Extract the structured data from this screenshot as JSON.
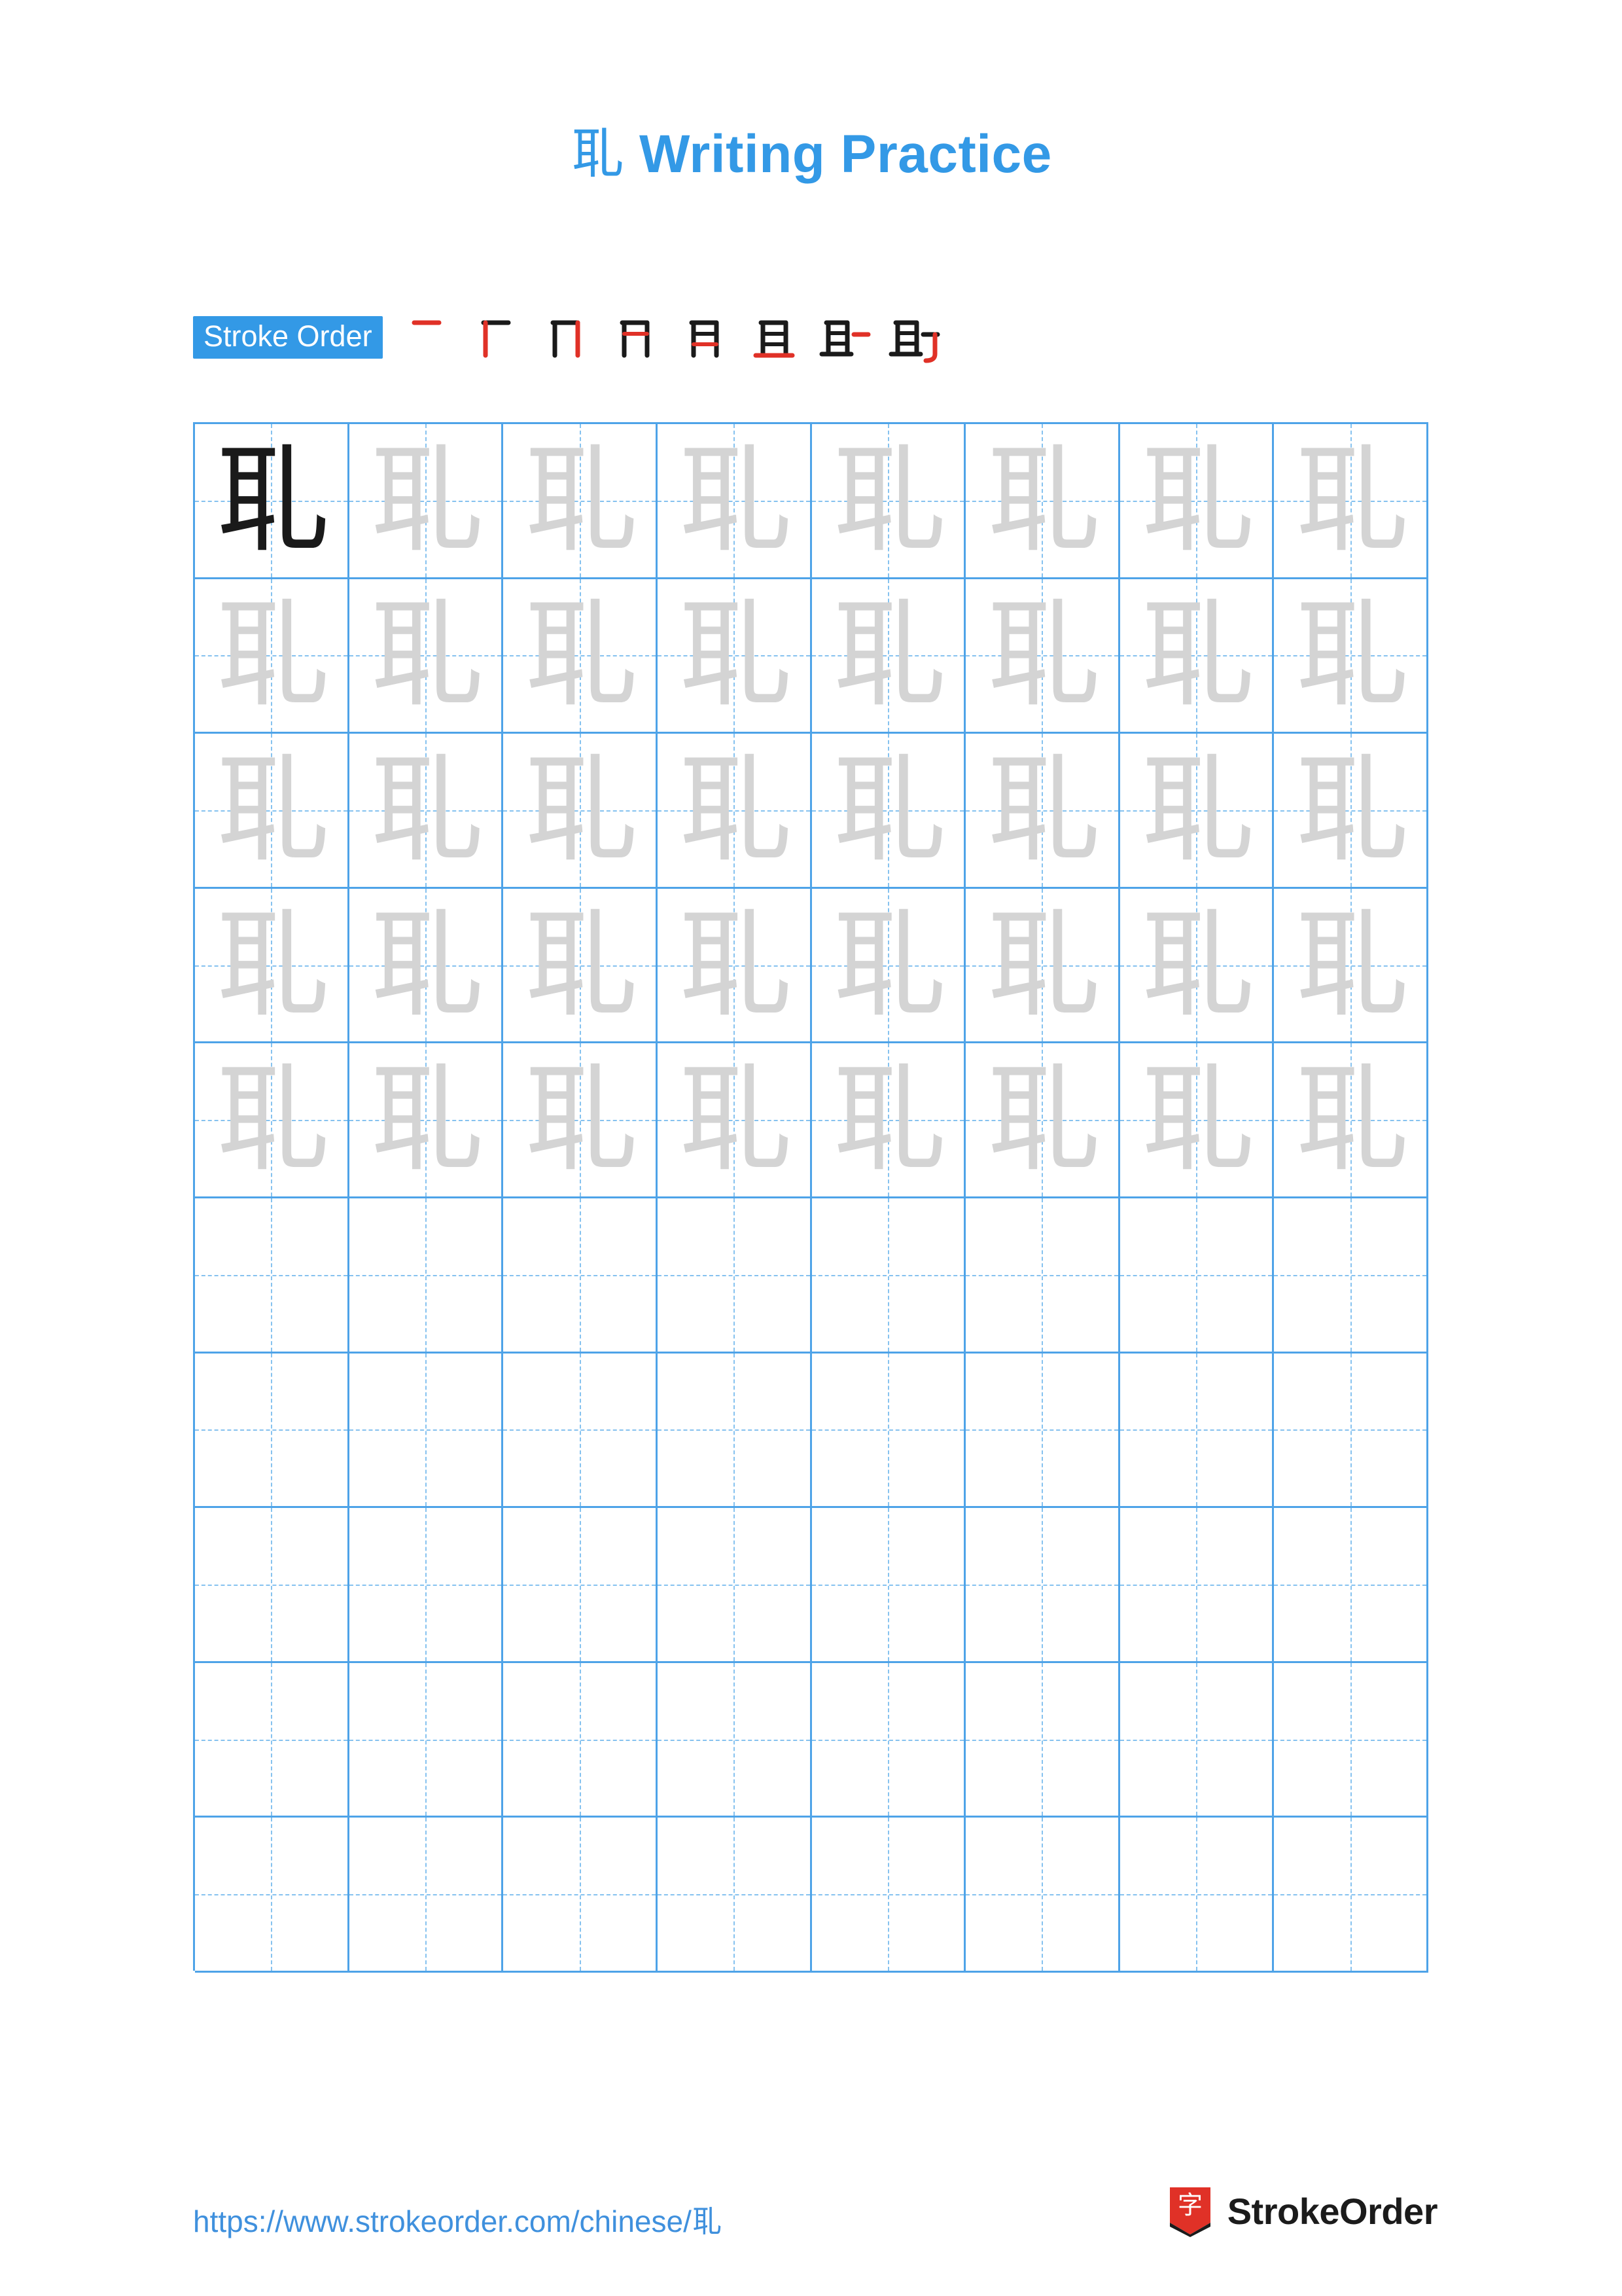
{
  "page": {
    "title_character": "耴",
    "title_suffix": " Writing Practice",
    "accent_color": "#3399e6",
    "grid_line_color": "#4ea3e8",
    "guide_line_color": "#86c2ef",
    "trace_glyph_color": "#d4d4d4",
    "model_glyph_color": "#1a1a1a"
  },
  "stroke_order": {
    "label": "Stroke Order",
    "character": "耴",
    "stroke_count": 8,
    "steps": [
      {
        "index": 1,
        "partial": "一",
        "new_stroke": "heng"
      },
      {
        "index": 2,
        "partial": "丆",
        "new_stroke": "shu"
      },
      {
        "index": 3,
        "partial": "刀",
        "new_stroke": "heng"
      },
      {
        "index": 4,
        "partial": "月",
        "new_stroke": "heng"
      },
      {
        "index": 5,
        "partial": "目",
        "new_stroke": "heng"
      },
      {
        "index": 6,
        "partial": "耳",
        "new_stroke": "heng"
      },
      {
        "index": 7,
        "partial": "耴",
        "new_stroke": "heng"
      },
      {
        "index": 8,
        "partial": "耴",
        "new_stroke": "shuwangou"
      }
    ]
  },
  "practice_grid": {
    "columns": 8,
    "rows": 10,
    "cells": [
      [
        "dark",
        "light",
        "light",
        "light",
        "light",
        "light",
        "light",
        "light"
      ],
      [
        "light",
        "light",
        "light",
        "light",
        "light",
        "light",
        "light",
        "light"
      ],
      [
        "light",
        "light",
        "light",
        "light",
        "light",
        "light",
        "light",
        "light"
      ],
      [
        "light",
        "light",
        "light",
        "light",
        "light",
        "light",
        "light",
        "light"
      ],
      [
        "light",
        "light",
        "light",
        "light",
        "light",
        "light",
        "light",
        "light"
      ],
      [
        "empty",
        "empty",
        "empty",
        "empty",
        "empty",
        "empty",
        "empty",
        "empty"
      ],
      [
        "empty",
        "empty",
        "empty",
        "empty",
        "empty",
        "empty",
        "empty",
        "empty"
      ],
      [
        "empty",
        "empty",
        "empty",
        "empty",
        "empty",
        "empty",
        "empty",
        "empty"
      ],
      [
        "empty",
        "empty",
        "empty",
        "empty",
        "empty",
        "empty",
        "empty",
        "empty"
      ],
      [
        "empty",
        "empty",
        "empty",
        "empty",
        "empty",
        "empty",
        "empty",
        "empty"
      ]
    ]
  },
  "footer": {
    "url": "https://www.strokeorder.com/chinese/耴",
    "brand_name": "StrokeOrder",
    "brand_logo_character": "字",
    "brand_logo_color": "#e03127"
  }
}
